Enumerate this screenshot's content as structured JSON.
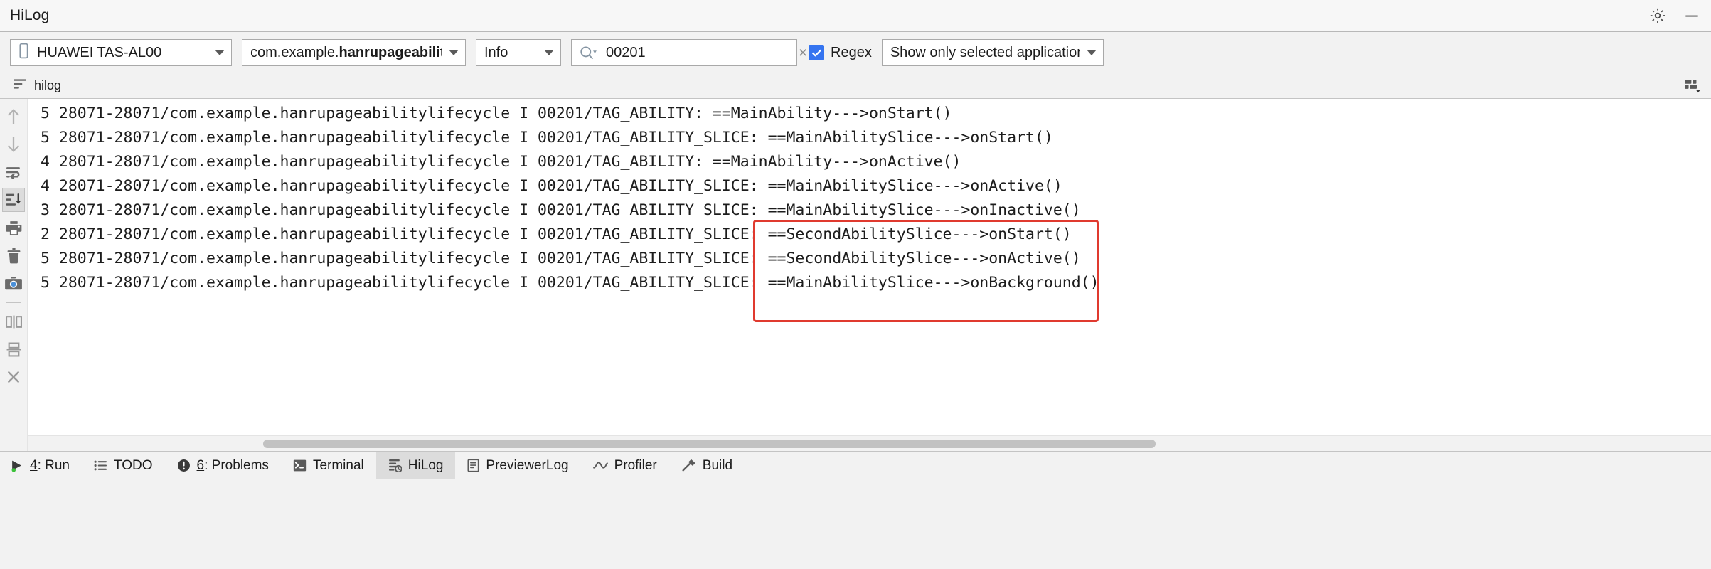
{
  "window": {
    "title": "HiLog",
    "actions": [
      {
        "name": "settings-icon",
        "label": "Settings"
      },
      {
        "name": "minimize-icon",
        "label": "Minimize"
      }
    ]
  },
  "toolbar": {
    "device": {
      "value": "HUAWEI TAS-AL00",
      "icon": "phone-icon"
    },
    "package": {
      "prefix": "com.example.",
      "bold": "hanrupageabilitylif",
      "full": "com.example.hanrupageabilitylifecycle"
    },
    "level": {
      "value": "Info"
    },
    "search": {
      "value": "00201",
      "placeholder": "",
      "icon": "search-icon",
      "clear": "×"
    },
    "regex": {
      "label": "Regex",
      "checked": true,
      "accent": "#3574f0"
    },
    "scope": {
      "value": "Show only selected application"
    }
  },
  "tabrow": {
    "tab_label": "hilog",
    "tab_icon": "log-filter-icon",
    "layout_toggle_icon": "layout-settings-icon"
  },
  "gutter": {
    "buttons": [
      {
        "name": "scroll-up-button",
        "icon": "arrow-up-icon",
        "active": false
      },
      {
        "name": "scroll-down-button",
        "icon": "arrow-down-icon",
        "active": false
      },
      {
        "name": "soft-wrap-button",
        "icon": "soft-wrap-icon",
        "active": false
      },
      {
        "name": "scroll-to-end-button",
        "icon": "scroll-to-end-icon",
        "active": true
      },
      {
        "name": "print-button",
        "icon": "printer-icon",
        "active": false
      },
      {
        "name": "clear-all-button",
        "icon": "trash-icon",
        "active": false
      },
      {
        "name": "screenshot-button",
        "icon": "camera-icon",
        "active": false
      },
      {
        "name": "split-vertically-button",
        "icon": "split-vertical-icon",
        "active": false
      },
      {
        "name": "split-horizontally-button",
        "icon": "split-horizontal-icon",
        "active": false
      },
      {
        "name": "close-button",
        "icon": "close-icon",
        "active": false
      }
    ]
  },
  "log": {
    "scroll_thumb_position_pct": 14,
    "highlight": {
      "color": "#e03a2f",
      "covers_lines": [
        5,
        6,
        7,
        8
      ],
      "covers_text": [
        "==MainAbilitySlice--->onInactive()",
        "==SecondAbilitySlice--->onStart()",
        "==SecondAbilitySlice--->onActive()",
        "==MainAbilitySlice--->onBackground()"
      ]
    },
    "lines": [
      "5 28071-28071/com.example.hanrupageabilitylifecycle I 00201/TAG_ABILITY: ==MainAbility--->onStart()",
      "5 28071-28071/com.example.hanrupageabilitylifecycle I 00201/TAG_ABILITY_SLICE: ==MainAbilitySlice--->onStart()",
      "4 28071-28071/com.example.hanrupageabilitylifecycle I 00201/TAG_ABILITY: ==MainAbility--->onActive()",
      "4 28071-28071/com.example.hanrupageabilitylifecycle I 00201/TAG_ABILITY_SLICE: ==MainAbilitySlice--->onActive()",
      "3 28071-28071/com.example.hanrupageabilitylifecycle I 00201/TAG_ABILITY_SLICE: ==MainAbilitySlice--->onInactive()",
      "2 28071-28071/com.example.hanrupageabilitylifecycle I 00201/TAG_ABILITY_SLICE: ==SecondAbilitySlice--->onStart()",
      "5 28071-28071/com.example.hanrupageabilitylifecycle I 00201/TAG_ABILITY_SLICE: ==SecondAbilitySlice--->onActive()",
      "5 28071-28071/com.example.hanrupageabilitylifecycle I 00201/TAG_ABILITY_SLICE: ==MainAbilitySlice--->onBackground()"
    ]
  },
  "statusbar": {
    "items": [
      {
        "name": "status-tab-run",
        "label_html": "4: Run",
        "label": "4: Run",
        "icon": "run-icon",
        "selected": false
      },
      {
        "name": "status-tab-todo",
        "label": "TODO",
        "icon": "todo-list-icon",
        "selected": false
      },
      {
        "name": "status-tab-problems",
        "label": "6: Problems",
        "icon": "problems-warning-icon",
        "selected": false
      },
      {
        "name": "status-tab-terminal",
        "label": "Terminal",
        "icon": "terminal-icon",
        "selected": false
      },
      {
        "name": "status-tab-hilog",
        "label": "HiLog",
        "icon": "hilog-icon",
        "selected": true
      },
      {
        "name": "status-tab-previewerlog",
        "label": "PreviewerLog",
        "icon": "previewer-log-icon",
        "selected": false
      },
      {
        "name": "status-tab-profiler",
        "label": "Profiler",
        "icon": "profiler-icon",
        "selected": false
      },
      {
        "name": "status-tab-build",
        "label": "Build",
        "icon": "hammer-build-icon",
        "selected": false
      }
    ]
  }
}
